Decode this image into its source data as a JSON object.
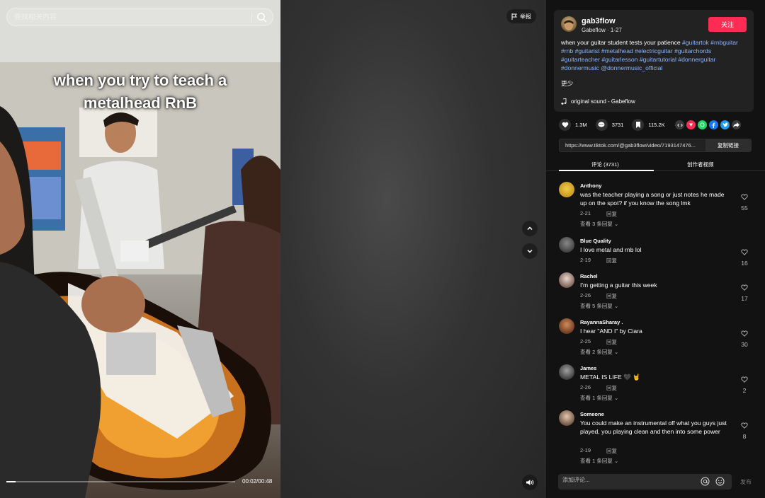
{
  "search": {
    "placeholder": "查找相关内容"
  },
  "video": {
    "caption_line1": "when you try to teach a",
    "caption_line2": "metalhead RnB",
    "time": "00:02/00:48",
    "progress": 0.04,
    "report_label": "举报"
  },
  "author": {
    "username": "gab3flow",
    "display_and_date": "Gabeflow · 1-27",
    "follow_label": "关注",
    "description": "when your guitar student tests your patience",
    "hashtags": [
      "#guitartok",
      "#rnbguitar",
      "#rnb",
      "#guitarist",
      "#metalhead",
      "#electricguitar",
      "#guitarchords",
      "#guitarteacher",
      "#guitarlesson",
      "#guitartutorial",
      "#donnerguitar",
      "#donnermusic",
      "@donnermusic_official"
    ],
    "more_label": "更少",
    "sound": "original sound - Gabeflow"
  },
  "stats": {
    "likes": "1.3M",
    "comments": "3731",
    "saves": "115.2K"
  },
  "share": {
    "link": "https://www.tiktok.com/@gab3flow/video/7193147476...",
    "copy_label": "复制链接",
    "icons": [
      "embed-icon",
      "tiktok-share-icon",
      "whatsapp-icon",
      "facebook-icon",
      "twitter-icon",
      "forward-icon"
    ],
    "colors": [
      "#3a3a3a",
      "#fe2c55",
      "#25d366",
      "#1877f2",
      "#1d9bf0",
      "#3a3a3a"
    ]
  },
  "tabs": {
    "comments": "评论 (3731)",
    "creator_videos": "创作者视频"
  },
  "comments": [
    {
      "name": "Anthony",
      "text": "was the teacher playing a song or just notes he made up on the spot? if you know the song lmk",
      "date": "2-21",
      "reply": "回复",
      "replies": "查看 3 条回复",
      "likes": "55"
    },
    {
      "name": "Blue Quality",
      "text": "I love metal and rnb lol",
      "date": "2-19",
      "reply": "回复",
      "replies": "",
      "likes": "16"
    },
    {
      "name": "Rachel",
      "text": "I'm getting a guitar this week",
      "date": "2-26",
      "reply": "回复",
      "replies": "查看 5 条回复",
      "likes": "17"
    },
    {
      "name": "RayannaSharay .",
      "text": "I hear \"AND I\" by Ciara",
      "date": "2-25",
      "reply": "回复",
      "replies": "查看 2 条回复",
      "likes": "30"
    },
    {
      "name": "James",
      "text": "METAL IS LIFE 🖤 🤘",
      "date": "2-26",
      "reply": "回复",
      "replies": "查看 1 条回复",
      "likes": "2"
    },
    {
      "name": "Someone",
      "text": "You could make an instrumental off what you guys just played, you playing clean and then into some power",
      "date": "2-19",
      "reply": "回复",
      "replies": "查看 1 条回复",
      "likes": "8"
    }
  ],
  "comment_input": {
    "placeholder": "添加评论...",
    "post_label": "发布"
  }
}
